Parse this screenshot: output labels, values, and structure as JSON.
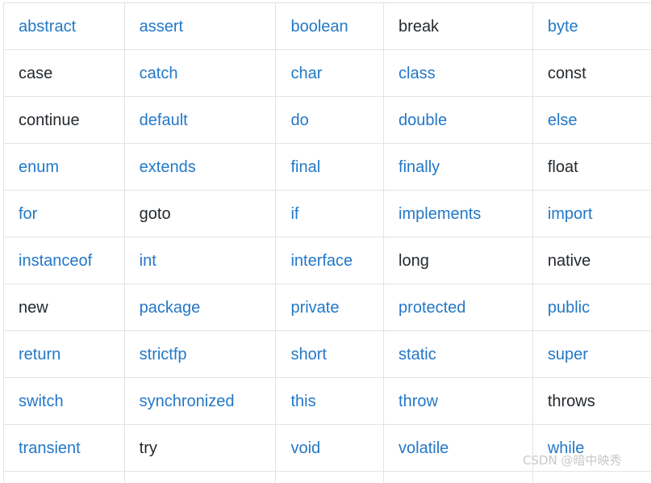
{
  "table": {
    "columns": 5,
    "rows": [
      [
        {
          "text": "abstract",
          "style": "link"
        },
        {
          "text": "assert",
          "style": "link"
        },
        {
          "text": "boolean",
          "style": "link"
        },
        {
          "text": "break",
          "style": "plain"
        },
        {
          "text": "byte",
          "style": "link"
        }
      ],
      [
        {
          "text": "case",
          "style": "plain"
        },
        {
          "text": "catch",
          "style": "link"
        },
        {
          "text": "char",
          "style": "link"
        },
        {
          "text": "class",
          "style": "link"
        },
        {
          "text": "const",
          "style": "plain"
        }
      ],
      [
        {
          "text": "continue",
          "style": "plain"
        },
        {
          "text": "default",
          "style": "link"
        },
        {
          "text": "do",
          "style": "link"
        },
        {
          "text": "double",
          "style": "link"
        },
        {
          "text": "else",
          "style": "link"
        }
      ],
      [
        {
          "text": "enum",
          "style": "link"
        },
        {
          "text": "extends",
          "style": "link"
        },
        {
          "text": "final",
          "style": "link"
        },
        {
          "text": "finally",
          "style": "link"
        },
        {
          "text": "float",
          "style": "plain"
        }
      ],
      [
        {
          "text": "for",
          "style": "link"
        },
        {
          "text": "goto",
          "style": "plain"
        },
        {
          "text": "if",
          "style": "link"
        },
        {
          "text": "implements",
          "style": "link"
        },
        {
          "text": "import",
          "style": "link"
        }
      ],
      [
        {
          "text": "instanceof",
          "style": "link"
        },
        {
          "text": "int",
          "style": "link"
        },
        {
          "text": "interface",
          "style": "link"
        },
        {
          "text": "long",
          "style": "plain"
        },
        {
          "text": "native",
          "style": "plain"
        }
      ],
      [
        {
          "text": "new",
          "style": "plain"
        },
        {
          "text": "package",
          "style": "link"
        },
        {
          "text": "private",
          "style": "link"
        },
        {
          "text": "protected",
          "style": "link"
        },
        {
          "text": "public",
          "style": "link"
        }
      ],
      [
        {
          "text": "return",
          "style": "link"
        },
        {
          "text": "strictfp",
          "style": "link"
        },
        {
          "text": "short",
          "style": "link"
        },
        {
          "text": "static",
          "style": "link"
        },
        {
          "text": "super",
          "style": "link"
        }
      ],
      [
        {
          "text": "switch",
          "style": "link"
        },
        {
          "text": "synchronized",
          "style": "link"
        },
        {
          "text": "this",
          "style": "link"
        },
        {
          "text": "throw",
          "style": "link"
        },
        {
          "text": "throws",
          "style": "plain"
        }
      ],
      [
        {
          "text": "transient",
          "style": "link"
        },
        {
          "text": "try",
          "style": "plain"
        },
        {
          "text": "void",
          "style": "link"
        },
        {
          "text": "volatile",
          "style": "link"
        },
        {
          "text": "while",
          "style": "link"
        }
      ]
    ],
    "partial_row_visible": true
  },
  "watermark": {
    "text": "CSDN @暗中映秀"
  },
  "colors": {
    "link": "#2378c8",
    "plain": "#24292e",
    "border": "#e3e3e3",
    "watermark": "#c8c8c8",
    "background": "#ffffff"
  }
}
